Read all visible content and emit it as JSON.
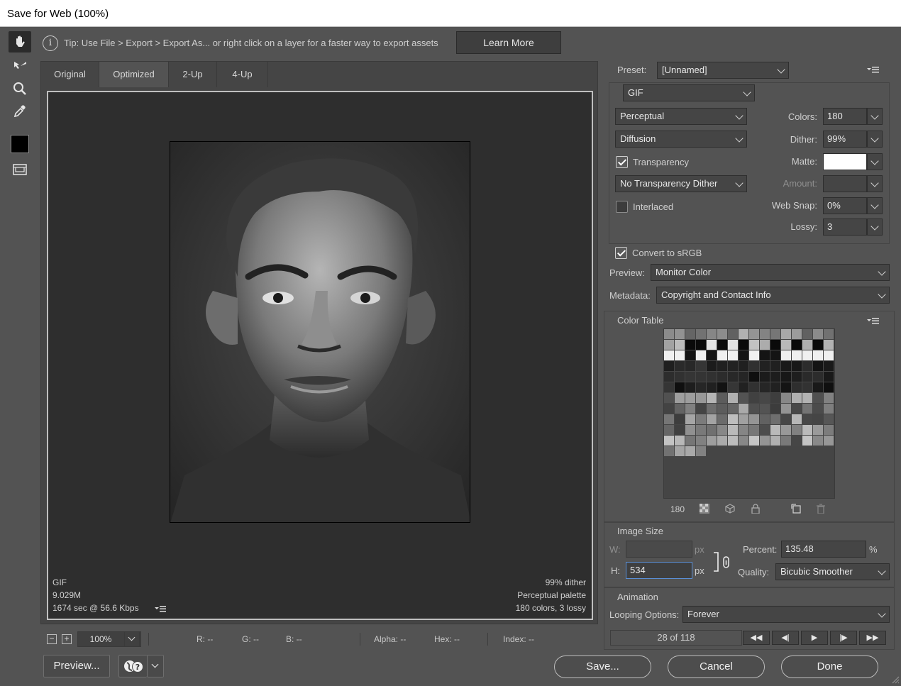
{
  "window": {
    "title": "Save for Web (100%)"
  },
  "tip": {
    "text": "Tip: Use File > Export > Export As...  or right click on a layer for a faster way to export assets",
    "learn_more": "Learn More"
  },
  "tabs": [
    {
      "label": "Original",
      "active": false
    },
    {
      "label": "Optimized",
      "active": true
    },
    {
      "label": "2-Up",
      "active": false
    },
    {
      "label": "4-Up",
      "active": false
    }
  ],
  "image_info": {
    "format": "GIF",
    "size": "9.029M",
    "time": "1674 sec @ 56.6 Kbps",
    "dither": "99% dither",
    "palette": "Perceptual palette",
    "colors_lossy": "180 colors, 3 lossy"
  },
  "status": {
    "zoom": "100%",
    "r": "R: --",
    "g": "G: --",
    "b": "B: --",
    "alpha": "Alpha: --",
    "hex": "Hex: --",
    "index": "Index: --"
  },
  "buttons": {
    "preview": "Preview...",
    "save": "Save...",
    "cancel": "Cancel",
    "done": "Done"
  },
  "settings": {
    "preset_label": "Preset:",
    "preset_value": "[Unnamed]",
    "format": "GIF",
    "reduction": "Perceptual",
    "dither_algo": "Diffusion",
    "transparency_label": "Transparency",
    "transparency_checked": true,
    "transparency_dither": "No Transparency Dither",
    "interlaced_label": "Interlaced",
    "interlaced_checked": false,
    "colors_label": "Colors:",
    "colors_value": "180",
    "dither_label": "Dither:",
    "dither_value": "99%",
    "matte_label": "Matte:",
    "matte_color": "#ffffff",
    "amount_label": "Amount:",
    "amount_value": "",
    "websnap_label": "Web Snap:",
    "websnap_value": "0%",
    "lossy_label": "Lossy:",
    "lossy_value": "3",
    "srgb_label": "Convert to sRGB",
    "srgb_checked": true,
    "preview_label": "Preview:",
    "preview_value": "Monitor Color",
    "metadata_label": "Metadata:",
    "metadata_value": "Copyright and Contact Info"
  },
  "color_table": {
    "title": "Color Table",
    "count": "180"
  },
  "image_size": {
    "title": "Image Size",
    "w_label": "W:",
    "w_value": "",
    "w_unit": "px",
    "h_label": "H:",
    "h_value": "534",
    "h_unit": "px",
    "percent_label": "Percent:",
    "percent_value": "135.48",
    "percent_unit": "%",
    "quality_label": "Quality:",
    "quality_value": "Bicubic Smoother"
  },
  "animation": {
    "title": "Animation",
    "looping_label": "Looping Options:",
    "looping_value": "Forever",
    "frame_text": "28 of 118"
  }
}
